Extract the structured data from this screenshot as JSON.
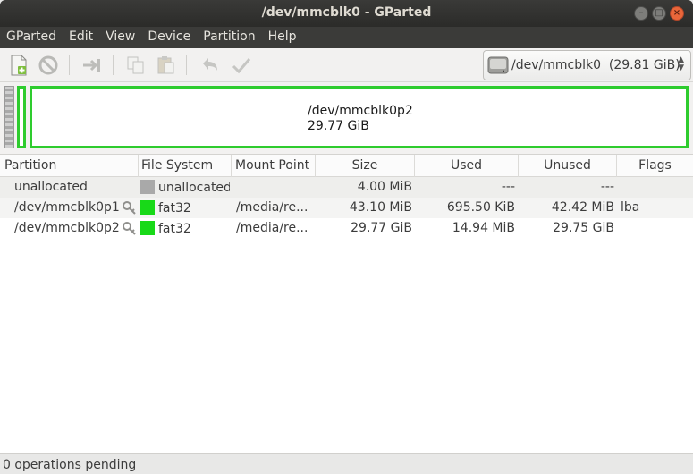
{
  "window": {
    "title": "/dev/mmcblk0 - GParted"
  },
  "menu": [
    "GParted",
    "Edit",
    "View",
    "Device",
    "Partition",
    "Help"
  ],
  "toolbar": {
    "icons": [
      "new-partition-icon",
      "delete-icon",
      "resize-move-icon",
      "copy-icon",
      "paste-icon",
      "undo-icon",
      "apply-icon"
    ]
  },
  "device_selector": {
    "value": "/dev/mmcblk0",
    "size": "(29.81 GiB)"
  },
  "map": {
    "selected_name": "/dev/mmcblk0p2",
    "selected_size": "29.77 GiB"
  },
  "table": {
    "columns": [
      "Partition",
      "File System",
      "Mount Point",
      "Size",
      "Used",
      "Unused",
      "Flags"
    ],
    "rows": [
      {
        "partition": "unallocated",
        "fs": "unallocated",
        "fs_color": "#a9a9a9",
        "mount": "",
        "size": "4.00 MiB",
        "used": "---",
        "unused": "---",
        "flags": "",
        "key": false
      },
      {
        "partition": "/dev/mmcblk0p1",
        "fs": "fat32",
        "fs_color": "#18d918",
        "mount": "/media/re...",
        "size": "43.10 MiB",
        "used": "695.50 KiB",
        "unused": "42.42 MiB",
        "flags": "lba",
        "key": true
      },
      {
        "partition": "/dev/mmcblk0p2",
        "fs": "fat32",
        "fs_color": "#18d918",
        "mount": "/media/re...",
        "size": "29.77 GiB",
        "used": "14.94 MiB",
        "unused": "29.75 GiB",
        "flags": "",
        "key": true
      }
    ]
  },
  "status": {
    "text": "0 operations pending"
  },
  "colors": {
    "fat32": "#18d918",
    "unallocated": "#a9a9a9",
    "menubar": "#3b3b39"
  }
}
